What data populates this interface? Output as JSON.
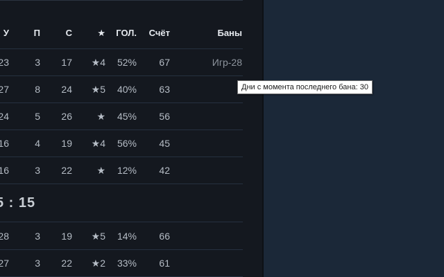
{
  "table": {
    "headers": {
      "wins": "У",
      "losses": "П",
      "kills": "С",
      "star": "★",
      "headshots": "ГОЛ.",
      "score": "Счёт",
      "bans": "Баны"
    },
    "team1_rows": [
      {
        "wins": "23",
        "losses": "3",
        "kills": "17",
        "star": "★4",
        "headshots": "52%",
        "score": "67",
        "bans": "Игр-28"
      },
      {
        "wins": "27",
        "losses": "8",
        "kills": "24",
        "star": "★5",
        "headshots": "40%",
        "score": "63",
        "bans": ""
      },
      {
        "wins": "24",
        "losses": "5",
        "kills": "26",
        "star": "★",
        "headshots": "45%",
        "score": "56",
        "bans": ""
      },
      {
        "wins": "16",
        "losses": "4",
        "kills": "19",
        "star": "★4",
        "headshots": "56%",
        "score": "45",
        "bans": ""
      },
      {
        "wins": "16",
        "losses": "3",
        "kills": "22",
        "star": "★",
        "headshots": "12%",
        "score": "42",
        "bans": ""
      }
    ],
    "match_score": "5 : 15",
    "team2_rows": [
      {
        "wins": "28",
        "losses": "3",
        "kills": "19",
        "star": "★5",
        "headshots": "14%",
        "score": "66",
        "bans": ""
      },
      {
        "wins": "27",
        "losses": "3",
        "kills": "22",
        "star": "★2",
        "headshots": "33%",
        "score": "61",
        "bans": ""
      }
    ]
  },
  "tooltip": {
    "text": "Дни с момента последнего бана: 30"
  },
  "colors": {
    "page_background": "#1b2838",
    "panel_background": "#14181f",
    "row_divider": "#263140",
    "text": "#b5bcc5",
    "header_text": "#e5e9ee"
  }
}
